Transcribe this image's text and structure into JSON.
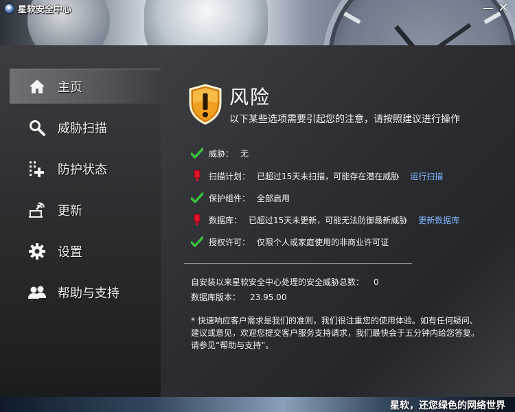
{
  "window": {
    "title": "星软安全中心",
    "minimize_glyph": "—",
    "close_glyph": "✕"
  },
  "sidebar": {
    "items": [
      {
        "label": "主页",
        "icon": "home-icon",
        "active": true
      },
      {
        "label": "威胁扫描",
        "icon": "search-icon",
        "active": false
      },
      {
        "label": "防护状态",
        "icon": "protection-grid-icon",
        "active": false
      },
      {
        "label": "更新",
        "icon": "update-icon",
        "active": false
      },
      {
        "label": "设置",
        "icon": "gear-icon",
        "active": false
      },
      {
        "label": "帮助与支持",
        "icon": "users-icon",
        "active": false
      }
    ]
  },
  "main": {
    "title": "风险",
    "subtitle": "以下某些选项需要引起您的注意，请按照建议进行操作",
    "status_items": [
      {
        "label": "威胁：",
        "value": "无",
        "status": "ok",
        "link": ""
      },
      {
        "label": "扫描计划：",
        "value": "已超过15天未扫描，可能存在潜在威胁",
        "status": "warning",
        "link": "运行扫描"
      },
      {
        "label": "保护组件：",
        "value": "全部启用",
        "status": "ok",
        "link": ""
      },
      {
        "label": "数据库：",
        "value": "已超过15天未更新，可能无法防御最新威胁",
        "status": "warning",
        "link": "更新数据库"
      },
      {
        "label": "授权许可：",
        "value": "仅限个人或家庭使用的非商业许可证",
        "status": "ok",
        "link": ""
      }
    ],
    "threats_total_label": "自安装以来星软安全中心处理的安全威胁总数：",
    "threats_total_value": "0",
    "db_version_label": "数据库版本：",
    "db_version_value": "23.95.00",
    "note": "* 快速响应客户需求是我们的准则，我们很注重您的使用体验。如有任何疑问、建议或意见，欢迎您提交客户服务支持请求，我们最快会于五分钟内给您答复。请参见“帮助与支持”。"
  },
  "footer": {
    "slogan": "星软，还您绿色的网络世界"
  },
  "colors": {
    "ok": "#3cc23c",
    "warning": "#e0142a",
    "link": "#7fb4ff",
    "shield": "#f0a020"
  }
}
